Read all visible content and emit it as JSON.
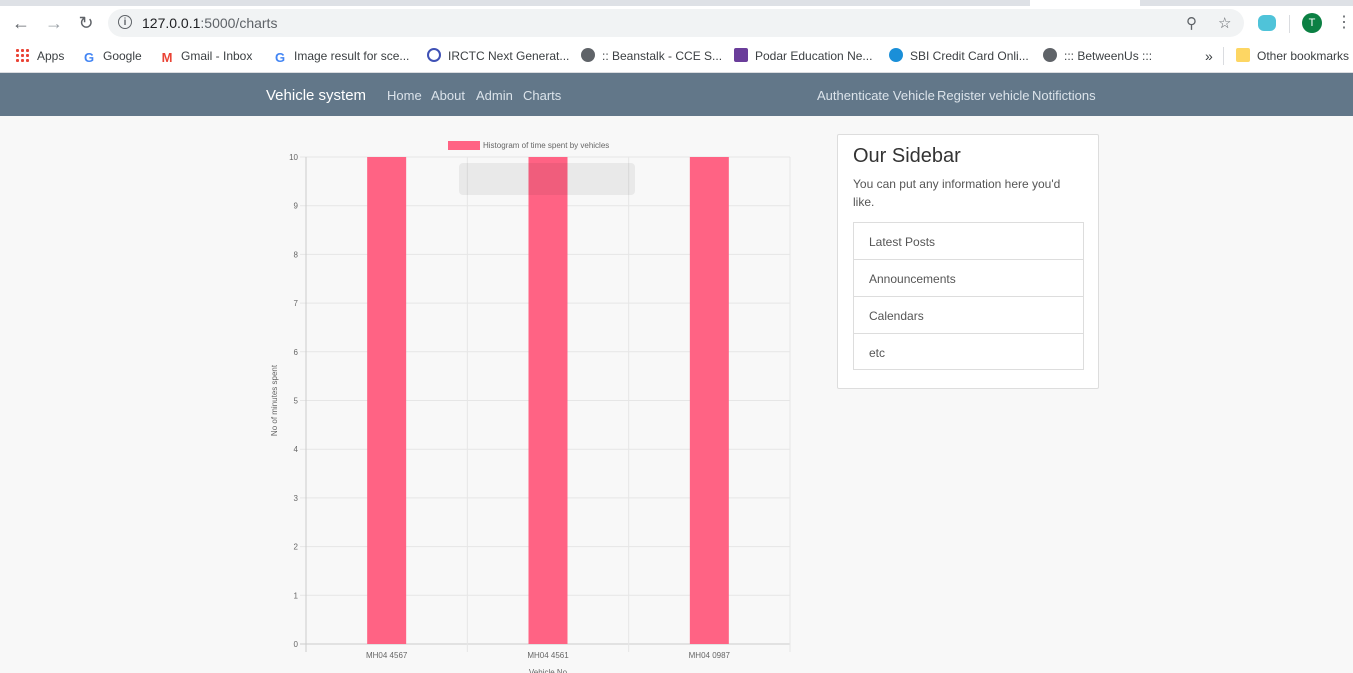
{
  "browser": {
    "url_host": "127.0.0.1",
    "url_path": ":5000/charts",
    "profile_initial": "T",
    "bookmarks": [
      {
        "label": "Apps"
      },
      {
        "label": "Google"
      },
      {
        "label": "Gmail - Inbox"
      },
      {
        "label": "Image result for sce..."
      },
      {
        "label": "IRCTC Next Generat..."
      },
      {
        "label": ":: Beanstalk - CCE S..."
      },
      {
        "label": "Podar Education Ne..."
      },
      {
        "label": "SBI Credit Card Onli..."
      },
      {
        "label": "::: BetweenUs :::"
      }
    ],
    "overflow": "»",
    "other_bookmarks": "Other bookmarks"
  },
  "navbar": {
    "brand": "Vehicle system",
    "left_links": [
      "Home",
      "About",
      "Admin",
      "Charts"
    ],
    "right_links": [
      "Authenticate Vehicle",
      "Register vehicle",
      "Notifictions"
    ]
  },
  "chart_data": {
    "type": "bar",
    "categories": [
      "MH04 4567",
      "MH04 4561",
      "MH04 0987"
    ],
    "series": [
      {
        "name": "Histogram of time spent by vehicles",
        "values": [
          10,
          10,
          10
        ],
        "color": "#ff6384"
      }
    ],
    "ylabel": "No of minutes spent",
    "xlabel": "Vehicle No",
    "ylim": [
      0,
      10
    ],
    "yticks": [
      0,
      1,
      2,
      3,
      4,
      5,
      6,
      7,
      8,
      9,
      10
    ],
    "grid": true,
    "legend_position": "top"
  },
  "sidebar": {
    "title": "Our Sidebar",
    "description": "You can put any information here you'd like.",
    "items": [
      "Latest Posts",
      "Announcements",
      "Calendars",
      "etc"
    ]
  }
}
